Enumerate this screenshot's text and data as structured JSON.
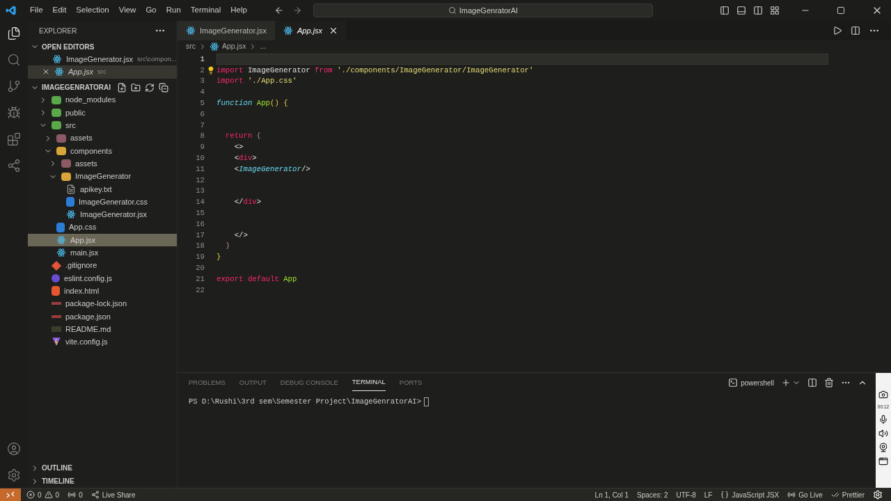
{
  "menu": [
    "File",
    "Edit",
    "Selection",
    "View",
    "Go",
    "Run",
    "Terminal",
    "Help"
  ],
  "title_search": "ImageGenratorAI",
  "activity": [
    {
      "kind": "files",
      "selected": true
    },
    {
      "kind": "search",
      "selected": false
    },
    {
      "kind": "git",
      "selected": false
    },
    {
      "kind": "debug",
      "selected": false
    },
    {
      "kind": "extensions",
      "selected": false
    },
    {
      "kind": "share",
      "selected": false
    }
  ],
  "explorer": {
    "title": "EXPLORER",
    "open_editors": {
      "title": "OPEN EDITORS",
      "expanded": true,
      "items": [
        {
          "name": "ImageGenerator.jsx",
          "path": "src\\compon...",
          "kind": "react",
          "preview": false,
          "selected": false
        },
        {
          "name": "App.jsx",
          "path": "src",
          "kind": "react",
          "preview": true,
          "selected": true
        }
      ]
    },
    "project": {
      "title": "IMAGEGENRATORAI",
      "expanded": true,
      "tree": [
        {
          "name": "node_modules",
          "kind": "folder-green",
          "expanded": false,
          "selected": false
        },
        {
          "name": "public",
          "kind": "folder-green",
          "expanded": false,
          "selected": false
        },
        {
          "name": "src",
          "kind": "folder-green",
          "expanded": true,
          "selected": false,
          "children": [
            {
              "name": "assets",
              "kind": "folder-red",
              "expanded": false,
              "selected": false
            },
            {
              "name": "components",
              "kind": "folder-yellow",
              "expanded": true,
              "selected": false,
              "children": [
                {
                  "name": "assets",
                  "kind": "folder-red",
                  "expanded": false,
                  "selected": false
                },
                {
                  "name": "ImageGenerator",
                  "kind": "folder-yellow",
                  "expanded": true,
                  "selected": false,
                  "children": [
                    {
                      "name": "apikey.txt",
                      "kind": "text",
                      "selected": false
                    },
                    {
                      "name": "ImageGenerator.css",
                      "kind": "css",
                      "selected": false
                    },
                    {
                      "name": "ImageGenerator.jsx",
                      "kind": "react",
                      "selected": false
                    }
                  ]
                }
              ]
            },
            {
              "name": "App.css",
              "kind": "css",
              "selected": false
            },
            {
              "name": "App.jsx",
              "kind": "react",
              "selected": true
            },
            {
              "name": "main.jsx",
              "kind": "react",
              "selected": false
            }
          ]
        },
        {
          "name": ".gitignore",
          "kind": "git",
          "selected": false
        },
        {
          "name": "eslint.config.js",
          "kind": "eslint",
          "selected": false
        },
        {
          "name": "index.html",
          "kind": "html",
          "selected": false
        },
        {
          "name": "package-lock.json",
          "kind": "json",
          "selected": false
        },
        {
          "name": "package.json",
          "kind": "json",
          "selected": false
        },
        {
          "name": "README.md",
          "kind": "md",
          "selected": false
        },
        {
          "name": "vite.config.js",
          "kind": "vite",
          "selected": false
        }
      ]
    },
    "sections": [
      {
        "title": "OUTLINE",
        "expanded": false
      },
      {
        "title": "TIMELINE",
        "expanded": false
      }
    ]
  },
  "tabs": [
    {
      "label": "ImageGenerator.jsx",
      "kind": "react",
      "selected": false,
      "preview": false
    },
    {
      "label": "App.jsx",
      "kind": "react",
      "selected": true,
      "preview": true
    }
  ],
  "breadcrumb": [
    "src",
    "App.jsx",
    "..."
  ],
  "code": [
    {
      "number": "1",
      "current": true
    },
    {
      "number": "2",
      "current": false,
      "bulb": true,
      "tokens": [
        {
          "text": "import",
          "kind": "kw"
        },
        {
          "text": " ImageGenerator ",
          "kind": "plain"
        },
        {
          "text": "from",
          "kind": "kw"
        },
        {
          "text": " './components/ImageGenerator/ImageGenerator'",
          "kind": "str"
        }
      ]
    },
    {
      "number": "3",
      "current": false,
      "tokens": [
        {
          "text": "import",
          "kind": "kw"
        },
        {
          "text": " './App.css'",
          "kind": "str"
        }
      ]
    },
    {
      "number": "4",
      "current": false
    },
    {
      "number": "5",
      "current": false,
      "tokens": [
        {
          "text": "function",
          "kind": "fn"
        },
        {
          "text": " App",
          "kind": "name"
        },
        {
          "text": "() {",
          "kind": "brace"
        }
      ]
    },
    {
      "number": "6",
      "current": false
    },
    {
      "number": "7",
      "current": false
    },
    {
      "number": "8",
      "current": false,
      "tokens": [
        {
          "text": "  return",
          "kind": "kw"
        },
        {
          "text": " (",
          "kind": "punct"
        }
      ]
    },
    {
      "number": "9",
      "current": false,
      "tokens": [
        {
          "text": "    <>",
          "kind": "plain"
        }
      ]
    },
    {
      "number": "10",
      "current": false,
      "tokens": [
        {
          "text": "    <",
          "kind": "plain"
        },
        {
          "text": "div",
          "kind": "kw"
        },
        {
          "text": ">",
          "kind": "plain"
        }
      ]
    },
    {
      "number": "11",
      "current": false,
      "tokens": [
        {
          "text": "    <",
          "kind": "plain"
        },
        {
          "text": "ImageGenerator",
          "kind": "comp"
        },
        {
          "text": "/>",
          "kind": "plain"
        }
      ]
    },
    {
      "number": "12",
      "current": false
    },
    {
      "number": "13",
      "current": false
    },
    {
      "number": "14",
      "current": false,
      "tokens": [
        {
          "text": "    </",
          "kind": "plain"
        },
        {
          "text": "div",
          "kind": "kw"
        },
        {
          "text": ">",
          "kind": "plain"
        }
      ]
    },
    {
      "number": "15",
      "current": false
    },
    {
      "number": "16",
      "current": false
    },
    {
      "number": "17",
      "current": false,
      "tokens": [
        {
          "text": "    </>",
          "kind": "plain"
        }
      ]
    },
    {
      "number": "18",
      "current": false,
      "tokens": [
        {
          "text": "  )",
          "kind": "punct"
        }
      ]
    },
    {
      "number": "19",
      "current": false,
      "tokens": [
        {
          "text": "}",
          "kind": "brace"
        }
      ]
    },
    {
      "number": "20",
      "current": false
    },
    {
      "number": "21",
      "current": false,
      "tokens": [
        {
          "text": "export default",
          "kind": "kw"
        },
        {
          "text": " App",
          "kind": "name"
        }
      ]
    },
    {
      "number": "22",
      "current": false
    }
  ],
  "panel": {
    "tabs": [
      {
        "label": "PROBLEMS",
        "selected": false
      },
      {
        "label": "OUTPUT",
        "selected": false
      },
      {
        "label": "DEBUG CONSOLE",
        "selected": false
      },
      {
        "label": "TERMINAL",
        "selected": true
      },
      {
        "label": "PORTS",
        "selected": false
      }
    ],
    "shell": "powershell",
    "prompt": "PS D:\\Rushi\\3rd sem\\Semester Project\\ImageGenratorAI>"
  },
  "status": {
    "left": [
      {
        "kind": "problems",
        "errors": "0",
        "warnings": "0"
      },
      {
        "kind": "ports",
        "text": "0"
      },
      {
        "kind": "liveshare",
        "text": "Live Share"
      }
    ],
    "right": [
      {
        "kind": "text",
        "text": "Ln 1, Col 1"
      },
      {
        "kind": "text",
        "text": "Spaces: 2"
      },
      {
        "kind": "text",
        "text": "UTF-8"
      },
      {
        "kind": "text",
        "text": "LF"
      },
      {
        "kind": "language",
        "text": "JavaScript JSX"
      },
      {
        "kind": "golive",
        "text": "Go Live"
      },
      {
        "kind": "prettier",
        "text": "Prettier"
      }
    ]
  },
  "recorder": {
    "time": "00:12"
  }
}
